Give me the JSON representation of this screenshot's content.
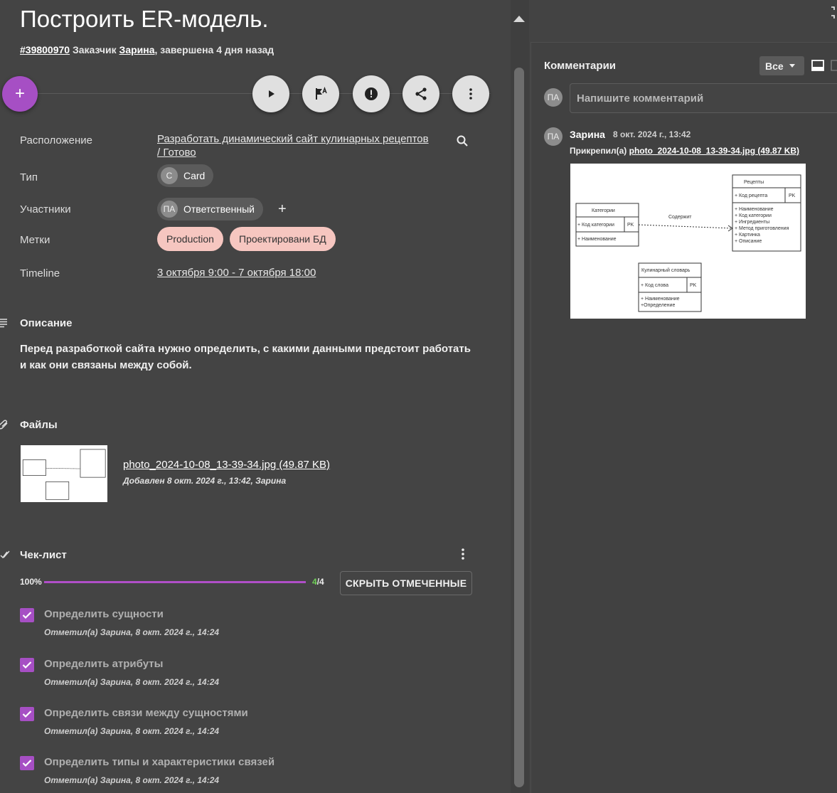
{
  "task": {
    "title": "Построить ER-модель.",
    "id": "#39800970",
    "customer_prefix": "Заказчик",
    "customer": "Зарина",
    "status_suffix": ", завершена 4 дня назад"
  },
  "properties": {
    "location_label": "Расположение",
    "location_value": "Разработать динамический сайт кулинарных рецептов",
    "location_value_2": "/ Готово",
    "type_label": "Тип",
    "type_avatar": "C",
    "type_value": "Card",
    "members_label": "Участники",
    "member_avatar": "ПА",
    "member_role": "Ответственный",
    "add_member": "+",
    "tags_label": "Метки",
    "tags": [
      "Production",
      "Проектировани БД"
    ],
    "timeline_label": "Timeline",
    "timeline_value": "3 октября 9:00 - 7 октября 18:00"
  },
  "description": {
    "title": "Описание",
    "line1": "Перед разработкой сайта нужно определить, с какими данными предстоит работать",
    "line2": "и как они связаны между собой."
  },
  "files": {
    "title": "Файлы",
    "name": "photo_2024-10-08_13-39-34.jpg (49.87 KB)",
    "meta": "Добавлен 8 окт. 2024 г., 13:42, Зарина"
  },
  "checklist": {
    "title": "Чек-лист",
    "percent": "100%",
    "progress": 1.0,
    "done": "4",
    "total": "/4",
    "hide_button": "СКРЫТЬ ОТМЕЧЕННЫЕ",
    "items": [
      {
        "text": "Определить сущности",
        "meta": "Отметил(а) Зарина, 8 окт. 2024 г., 14:24"
      },
      {
        "text": "Определить атрибуты",
        "meta": "Отметил(а) Зарина, 8 окт. 2024 г., 14:24"
      },
      {
        "text": "Определить связи между сущностями",
        "meta": "Отметил(а) Зарина, 8 окт. 2024 г., 14:24"
      },
      {
        "text": "Определить типы и характеристики связей",
        "meta": "Отметил(а) Зарина, 8 окт. 2024 г., 14:24"
      }
    ]
  },
  "comments": {
    "title": "Комментарии",
    "filter": "Все",
    "input_avatar": "ПА",
    "placeholder": "Напишите комментарий",
    "entry_avatar": "ПА",
    "author": "Зарина",
    "date": "8 окт. 2024 г., 13:42",
    "attached_prefix": "Прикрепил(а)",
    "attached_file": "photo_2024-10-08_13-39-34.jpg (49.87 KB)"
  },
  "diagram": {
    "recipes_title": "Рецепты",
    "recipes_key": "+ Код рецепта",
    "recipes_attrs": [
      "+ Наименование",
      "+ Код категории",
      "+ Ингредиенты",
      "+ Метод приготовления",
      "+ Картинка",
      "+ Описание"
    ],
    "categories_title": "Категории",
    "categories_key": "+ Код категории",
    "categories_attrs": [
      "+ Наименование"
    ],
    "relation": "Содержит",
    "dictionary_title": "Кулинарный словарь",
    "dictionary_key": "+ Код слова",
    "dictionary_attrs": [
      "+ Наименование",
      "+Определение"
    ],
    "pk": "PK"
  },
  "colors": {
    "accent": "#a64fc4",
    "tag": "#f6c6c0",
    "done_count": "#6fcf57"
  }
}
